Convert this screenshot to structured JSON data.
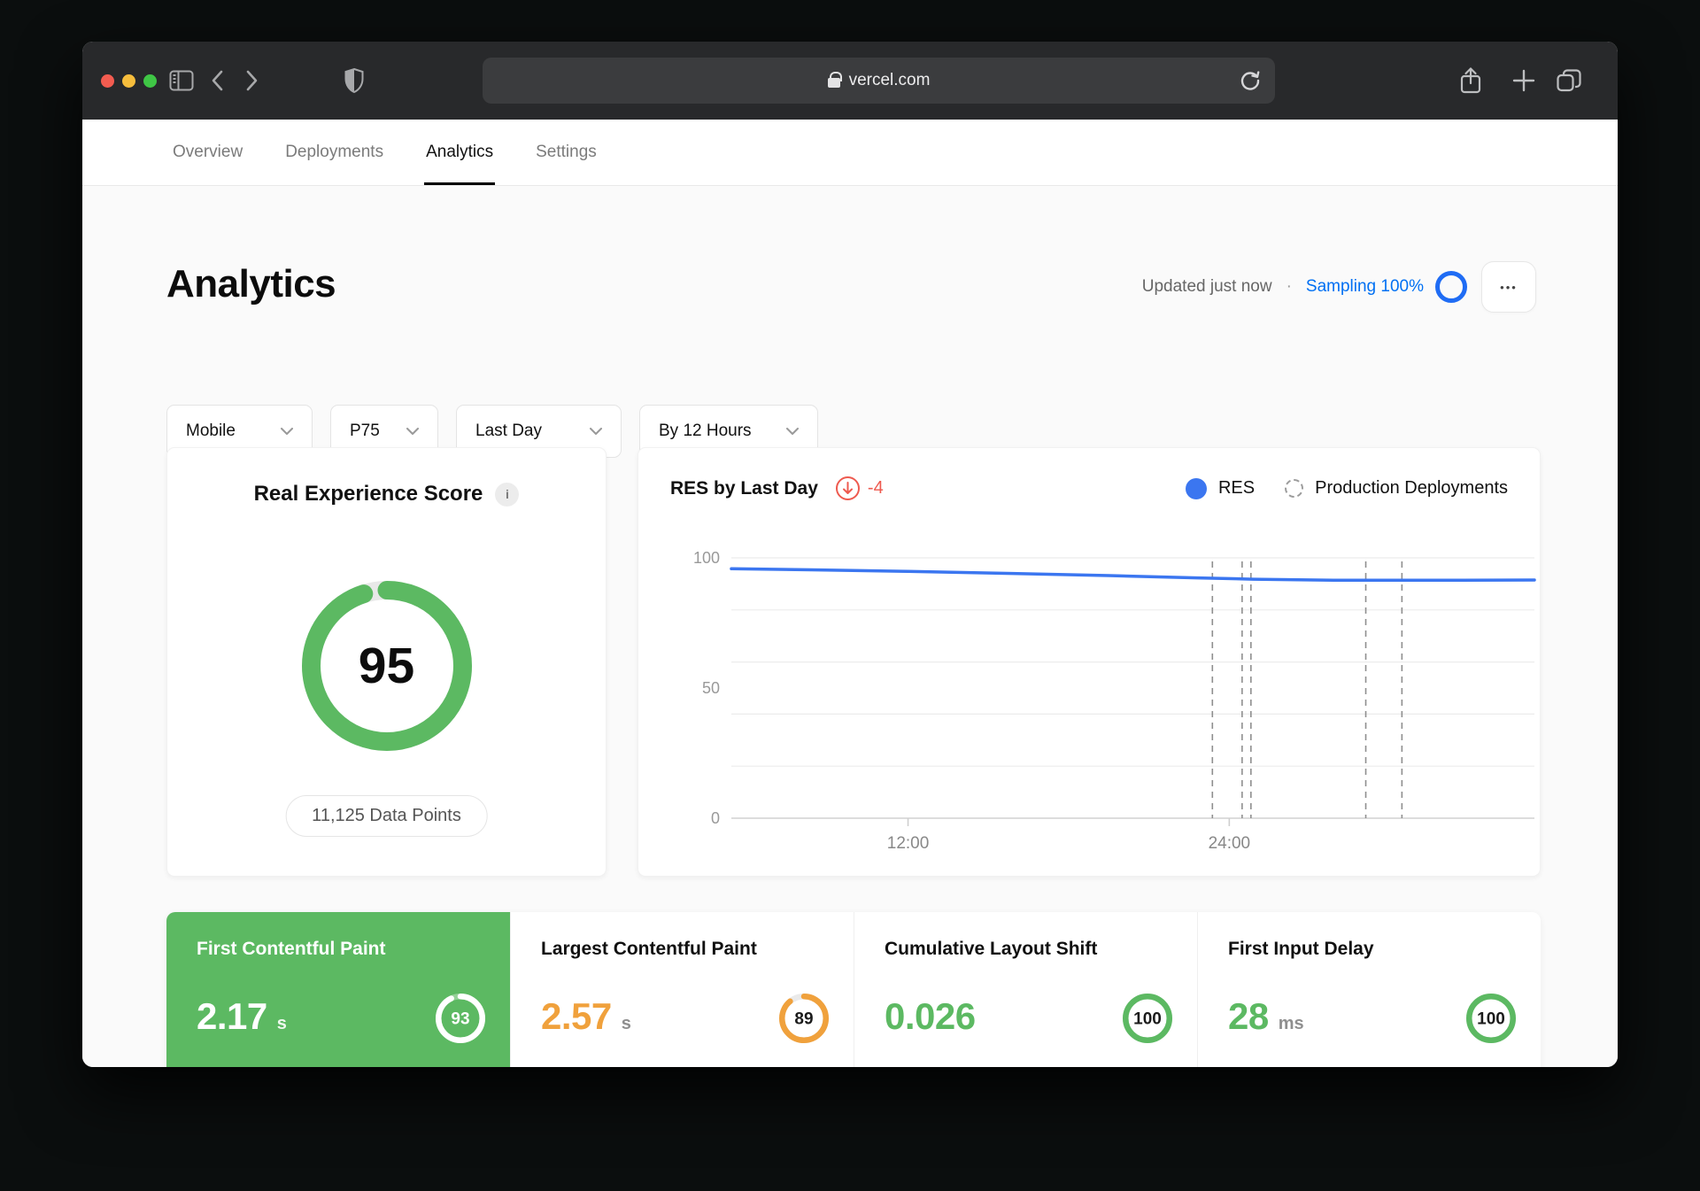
{
  "browser": {
    "url_host": "vercel.com",
    "toolbar_bg": "#28292b",
    "traffic_light_colors": [
      "#f35c50",
      "#f6bd3c",
      "#3fc645"
    ]
  },
  "tabs": [
    {
      "label": "Overview",
      "active": false
    },
    {
      "label": "Deployments",
      "active": false
    },
    {
      "label": "Analytics",
      "active": true
    },
    {
      "label": "Settings",
      "active": false
    }
  ],
  "page": {
    "title": "Analytics",
    "updated": "Updated just now",
    "dot": "·",
    "sampling": "Sampling 100%",
    "sampling_color": "#0070f3",
    "menu_dots": "•••"
  },
  "filters": [
    {
      "label": "Mobile"
    },
    {
      "label": "P75"
    },
    {
      "label": "Last Day"
    },
    {
      "label": "By 12 Hours"
    }
  ],
  "res_card": {
    "title": "Real Experience Score",
    "info": "i",
    "score": 95,
    "max": 100,
    "ring_color": "#5cb962",
    "track_color": "#e8e8e8",
    "button": "11,125 Data Points"
  },
  "chart_card": {
    "title": "RES by Last Day",
    "delta_value": "-4",
    "delta_color": "#ee5a4f",
    "legend": [
      {
        "label": "RES",
        "marker": "solid-dot",
        "color": "#3b76f0"
      },
      {
        "label": "Production Deployments",
        "marker": "dashed-circle",
        "color": "#9c9c9c"
      }
    ]
  },
  "chart_data": {
    "type": "line",
    "title": "RES by Last Day",
    "xlabel": "",
    "ylabel": "",
    "ylim": [
      0,
      100
    ],
    "grid": true,
    "gridlines_y": [
      0,
      20,
      40,
      60,
      80,
      100
    ],
    "y_tick_labels": [
      100,
      50,
      0
    ],
    "x_ticks": [
      {
        "label": "12:00",
        "pos": 0.22
      },
      {
        "label": "24:00",
        "pos": 0.62
      }
    ],
    "legend_position": "top-right",
    "series": [
      {
        "name": "RES",
        "color": "#3b76f0",
        "points": [
          [
            0,
            95.8
          ],
          [
            0.1,
            95.4
          ],
          [
            0.22,
            94.8
          ],
          [
            0.35,
            94.0
          ],
          [
            0.47,
            93.2
          ],
          [
            0.58,
            92.3
          ],
          [
            0.65,
            91.8
          ],
          [
            0.75,
            91.4
          ],
          [
            0.88,
            91.4
          ],
          [
            1,
            91.5
          ]
        ]
      }
    ],
    "deployments": {
      "name": "Production Deployments",
      "style": "dashed-vertical-line",
      "x_positions": [
        0.599,
        0.636,
        0.647,
        0.79,
        0.835
      ]
    }
  },
  "metrics": [
    {
      "title": "First Contentful Paint",
      "value": "2.17",
      "unit": "s",
      "score": 93,
      "selected": true,
      "bg": "#5cb962",
      "value_color": "#ffffff",
      "ring_color": "#ffffff"
    },
    {
      "title": "Largest Contentful Paint",
      "value": "2.57",
      "unit": "s",
      "score": 89,
      "selected": false,
      "value_color": "#f0a13c",
      "ring_color": "#f0a13c"
    },
    {
      "title": "Cumulative Layout Shift",
      "value": "0.026",
      "unit": "",
      "score": 100,
      "selected": false,
      "value_color": "#5cb962",
      "ring_color": "#5cb962"
    },
    {
      "title": "First Input Delay",
      "value": "28",
      "unit": "ms",
      "score": 100,
      "selected": false,
      "value_color": "#5cb962",
      "ring_color": "#5cb962"
    }
  ]
}
